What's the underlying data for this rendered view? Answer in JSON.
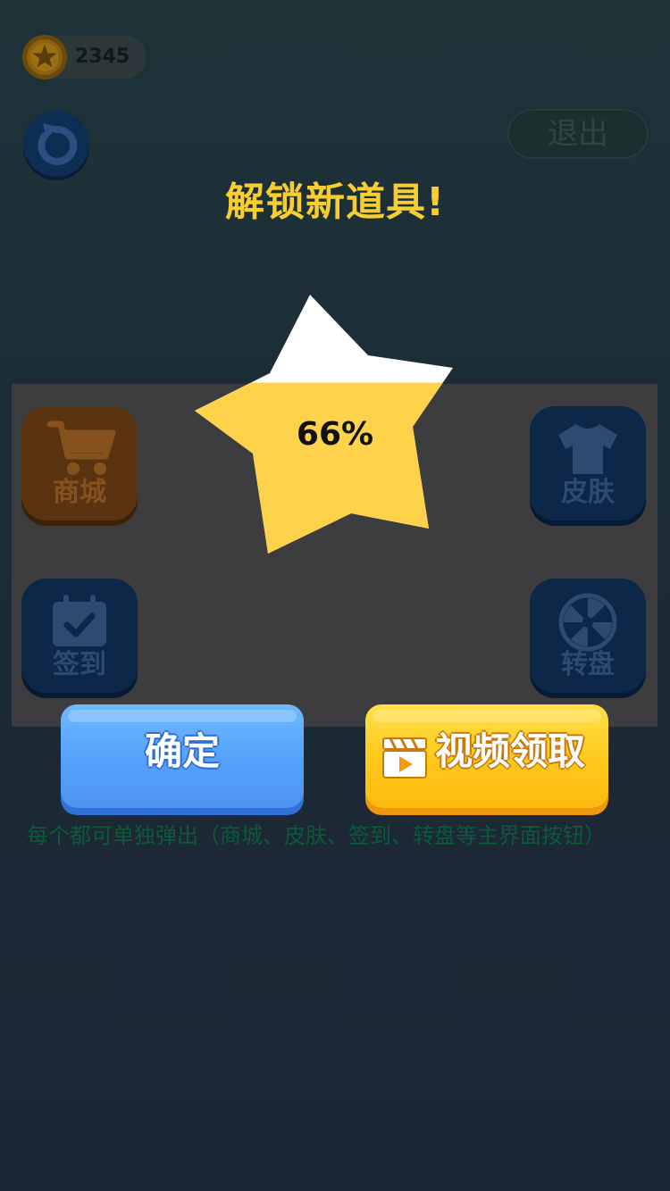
{
  "hud": {
    "coins": "2345",
    "exit_label": "退出"
  },
  "popup": {
    "title": "解锁新道具!",
    "progress_text": "66%",
    "progress": 0.66,
    "confirm_label": "确定",
    "video_label": "视频领取"
  },
  "menu": {
    "shop_label": "商城",
    "skin_label": "皮肤",
    "checkin_label": "签到",
    "wheel_label": "转盘"
  },
  "hint": "每个都可单独弹出（商城、皮肤、签到、转盘等主界面按钮）",
  "colors": {
    "title": "#f7cd2f",
    "star_fill": "#fed24a",
    "star_empty": "#ffffff",
    "confirm_button": "#55a1fb",
    "video_button": "#ffc81a"
  },
  "icons": {
    "coin": "star-coin-icon",
    "refresh": "refresh-icon",
    "shop": "shopping-cart-icon",
    "skin": "tshirt-icon",
    "checkin": "calendar-check-icon",
    "wheel": "wheel-icon",
    "video": "clapperboard-icon"
  }
}
